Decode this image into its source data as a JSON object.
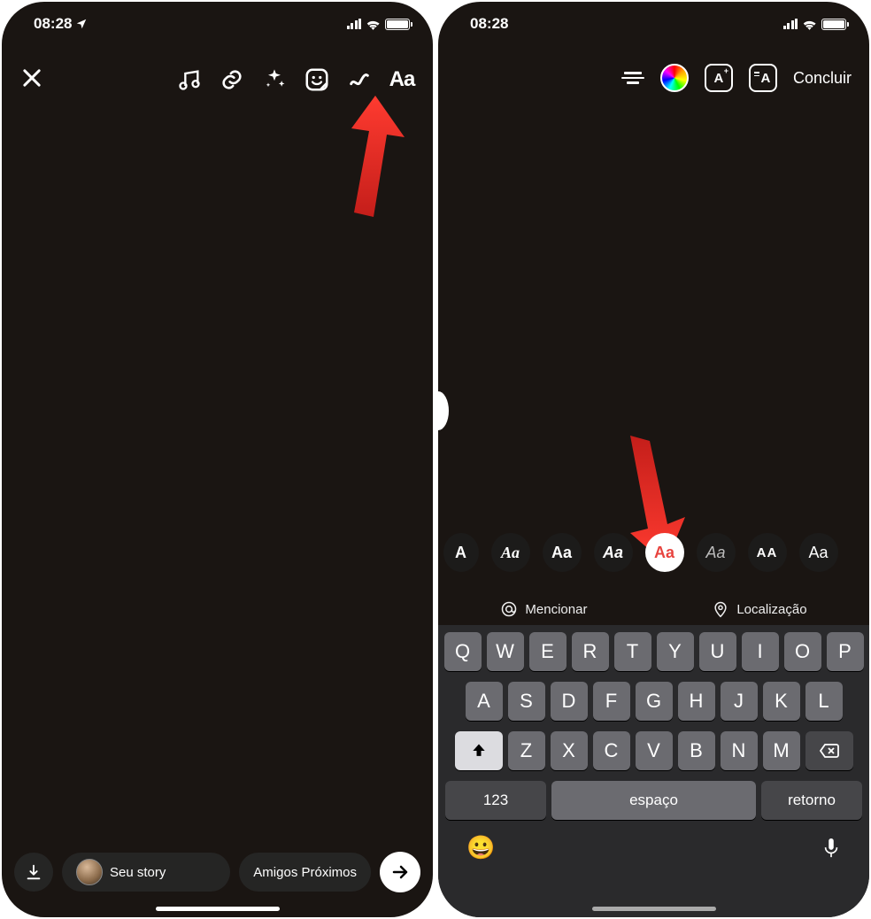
{
  "status": {
    "time": "08:28",
    "location_arrow": true
  },
  "left_screen": {
    "toolbar_icons": [
      "music-icon",
      "link-icon",
      "sparkle-icon",
      "sticker-icon",
      "draw-icon",
      "text-icon"
    ],
    "text_icon_label": "Aa",
    "bottom": {
      "your_story": "Seu story",
      "close_friends": "Amigos Próximos"
    }
  },
  "right_screen": {
    "done_label": "Concluir",
    "box1_label": "A",
    "box2_label": "A",
    "font_options": [
      {
        "label": "A",
        "style": "partial"
      },
      {
        "label": "Aa",
        "style": "serif"
      },
      {
        "label": "Aa",
        "style": "sans"
      },
      {
        "label": "Aa",
        "style": "bold-italic"
      },
      {
        "label": "Aa",
        "style": "selected"
      },
      {
        "label": "Aa",
        "style": "light-italic"
      },
      {
        "label": "AA",
        "style": "caps"
      },
      {
        "label": "Aa",
        "style": "mix"
      }
    ],
    "suggestions": {
      "mention": "Mencionar",
      "location": "Localização"
    },
    "keyboard": {
      "row1": [
        "Q",
        "W",
        "E",
        "R",
        "T",
        "Y",
        "U",
        "I",
        "O",
        "P"
      ],
      "row2": [
        "A",
        "S",
        "D",
        "F",
        "G",
        "H",
        "J",
        "K",
        "L"
      ],
      "row3": [
        "Z",
        "X",
        "C",
        "V",
        "B",
        "N",
        "M"
      ],
      "numbers_key": "123",
      "space_key": "espaço",
      "return_key": "retorno"
    }
  }
}
